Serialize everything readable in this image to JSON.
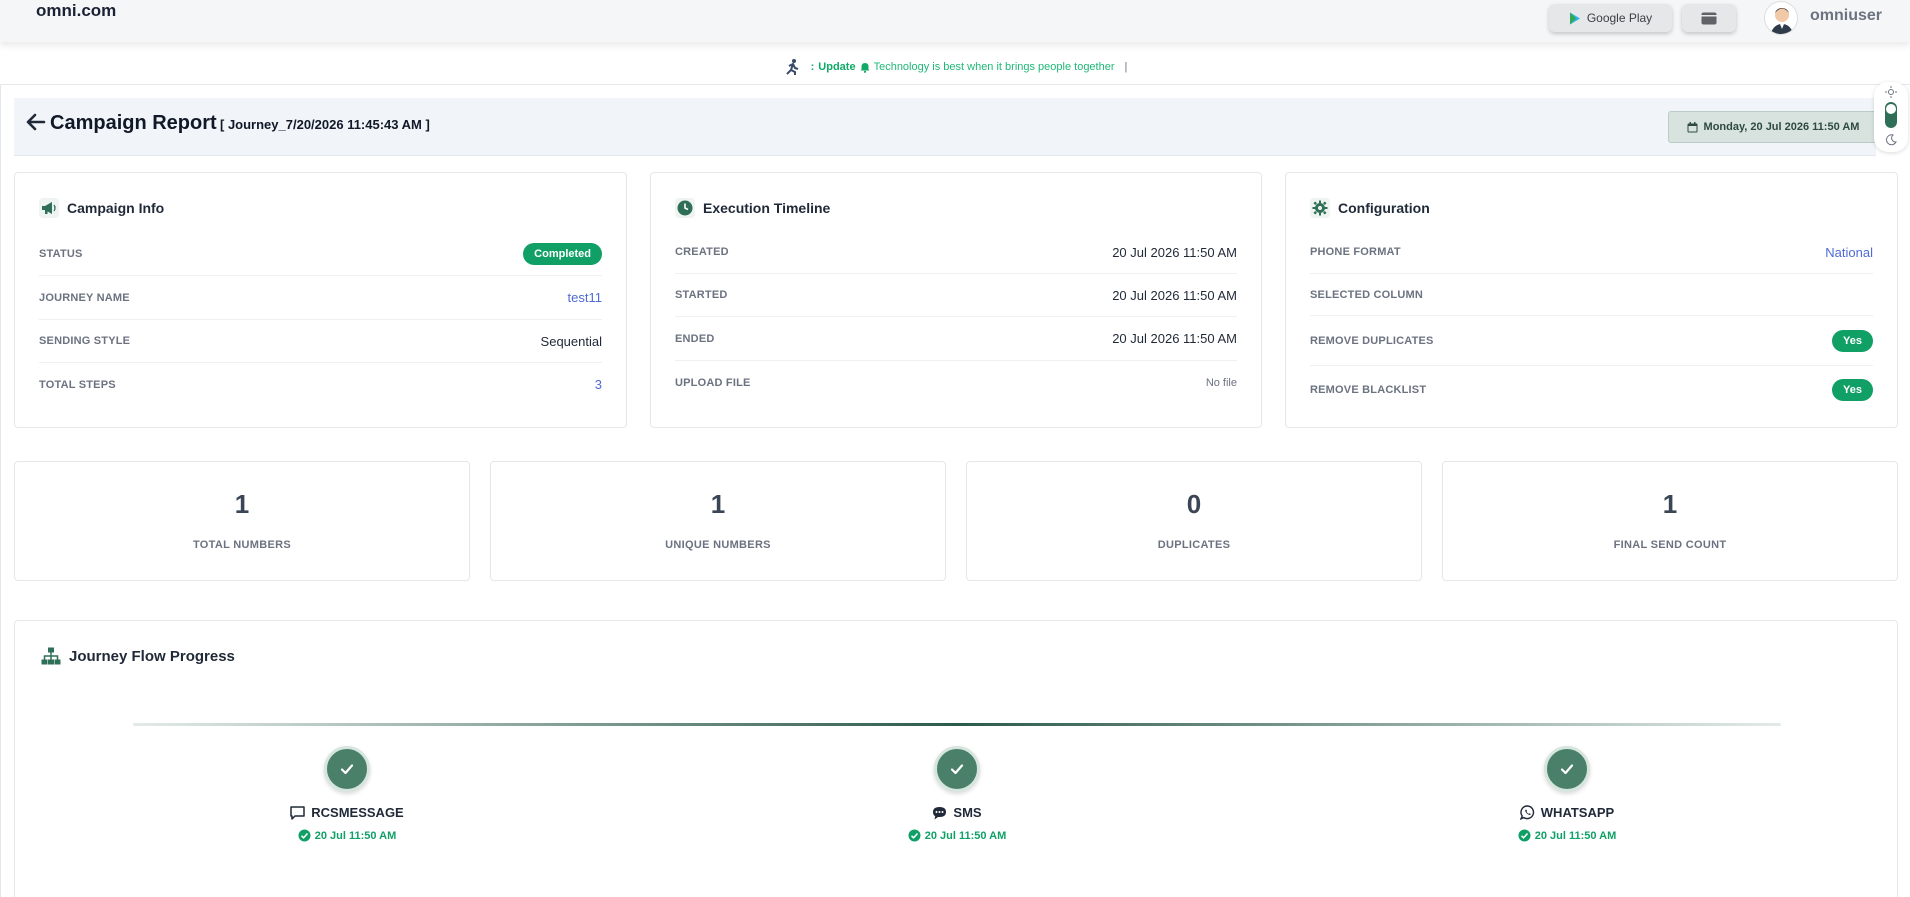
{
  "app": {
    "logo": "omni.com",
    "google_play_label": "Google Play",
    "username": "omniuser"
  },
  "ticker": {
    "prefix": ":",
    "update_label": "Update",
    "message": "Technology is best when it brings people together",
    "cursor": "|"
  },
  "header": {
    "title": "Campaign Report",
    "subtitle": "[ Journey_7/20/2026 11:45:43 AM ]",
    "date_label": "Monday, 20 Jul 2026 11:50 AM"
  },
  "campaign_info": {
    "title": "Campaign Info",
    "rows": [
      {
        "key": "STATUS",
        "value": "Completed"
      },
      {
        "key": "JOURNEY NAME",
        "value": "test11"
      },
      {
        "key": "SENDING STYLE",
        "value": "Sequential"
      },
      {
        "key": "TOTAL STEPS",
        "value": "3"
      }
    ]
  },
  "execution_timeline": {
    "title": "Execution Timeline",
    "rows": [
      {
        "key": "CREATED",
        "value": "20 Jul 2026 11:50 AM"
      },
      {
        "key": "STARTED",
        "value": "20 Jul 2026 11:50 AM"
      },
      {
        "key": "ENDED",
        "value": "20 Jul 2026 11:50 AM"
      },
      {
        "key": "UPLOAD FILE",
        "value": "No file"
      }
    ]
  },
  "configuration": {
    "title": "Configuration",
    "rows": [
      {
        "key": "PHONE FORMAT",
        "value": "National"
      },
      {
        "key": "SELECTED COLUMN",
        "value": ""
      },
      {
        "key": "REMOVE DUPLICATES",
        "value": "Yes"
      },
      {
        "key": "REMOVE BLACKLIST",
        "value": "Yes"
      }
    ]
  },
  "stats": [
    {
      "value": "1",
      "label": "TOTAL NUMBERS"
    },
    {
      "value": "1",
      "label": "UNIQUE NUMBERS"
    },
    {
      "value": "0",
      "label": "DUPLICATES"
    },
    {
      "value": "1",
      "label": "FINAL SEND COUNT"
    }
  ],
  "journey": {
    "title": "Journey Flow Progress",
    "steps": [
      {
        "name": "RCSMESSAGE",
        "time": "20 Jul 11:50 AM",
        "icon": "chat-bubble-icon"
      },
      {
        "name": "SMS",
        "time": "20 Jul 11:50 AM",
        "icon": "sms-icon"
      },
      {
        "name": "WHATSAPP",
        "time": "20 Jul 11:50 AM",
        "icon": "whatsapp-icon"
      }
    ]
  },
  "colors": {
    "accent_green": "#10a066",
    "step_green": "#4a8069",
    "link_blue": "#4f6bd6"
  }
}
